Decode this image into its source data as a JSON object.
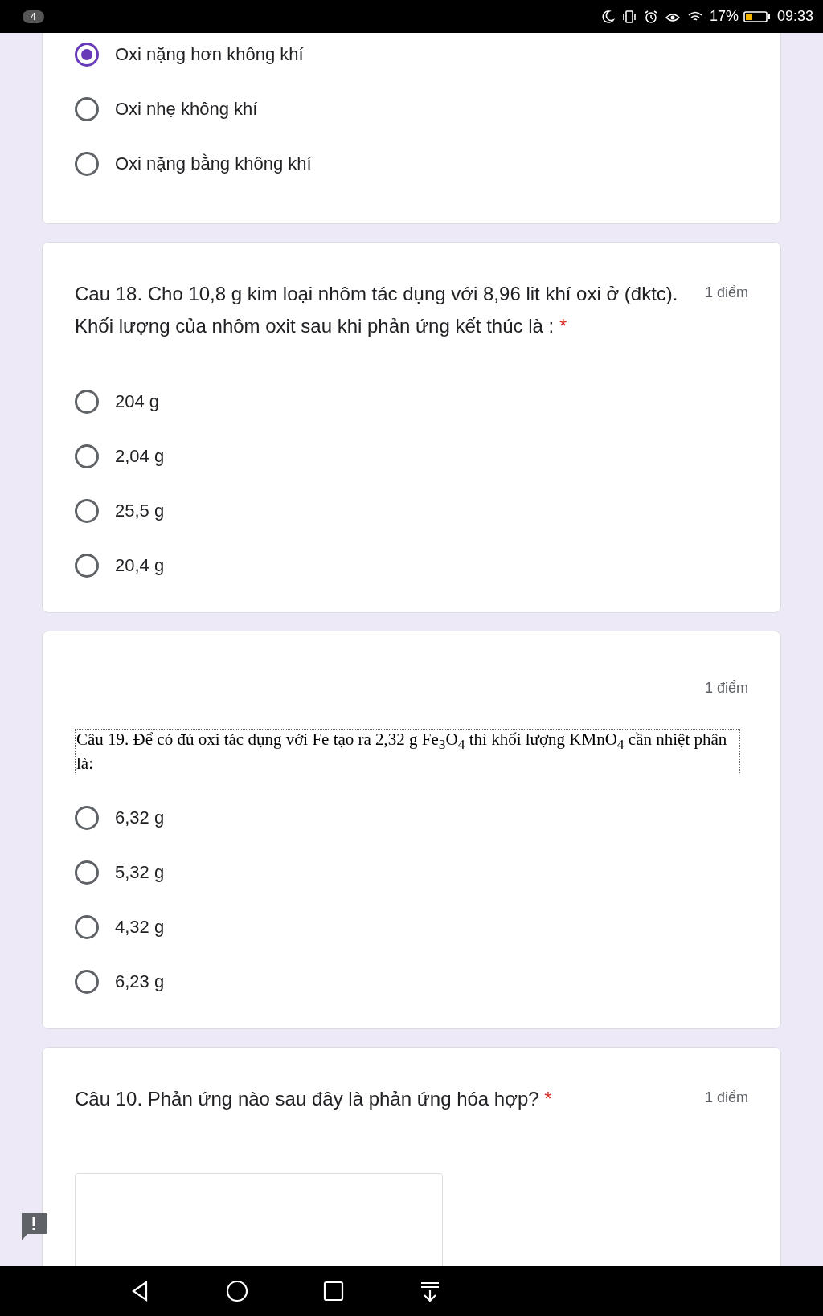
{
  "status_bar": {
    "notification_count": "4",
    "battery": "17%",
    "time": "09:33"
  },
  "questions": [
    {
      "options": [
        {
          "label": "Oxi nặng hơn không khí",
          "selected": true
        },
        {
          "label": "Oxi nhẹ không khí",
          "selected": false
        },
        {
          "label": "Oxi nặng bằng không khí",
          "selected": false
        }
      ]
    },
    {
      "title": "Cau 18. Cho 10,8 g kim loại nhôm tác dụng với 8,96 lit khí oxi ở (đktc). Khối lượng của nhôm oxit sau khi phản ứng kết thúc là :",
      "required_mark": "*",
      "points": "1 điểm",
      "options": [
        {
          "label": "204 g",
          "selected": false
        },
        {
          "label": "2,04 g",
          "selected": false
        },
        {
          "label": "25,5 g",
          "selected": false
        },
        {
          "label": "20,4 g",
          "selected": false
        }
      ]
    },
    {
      "points": "1 điểm",
      "document_text": "Câu 19. Để có đủ oxi tác dụng với Fe tạo ra 2,32 g Fe$_{3}$O$_{4}$ thì khối lượng KMnO$_{4}$ cần nhiệt phân là:",
      "options": [
        {
          "label": "6,32 g",
          "selected": false
        },
        {
          "label": "5,32 g",
          "selected": false
        },
        {
          "label": "4,32 g",
          "selected": false
        },
        {
          "label": "6,23 g",
          "selected": false
        }
      ]
    },
    {
      "title": "Câu 10. Phản ứng nào sau đây là phản ứng hóa hợp?",
      "required_mark": "*",
      "points": "1 điểm",
      "answer": {
        "kind": "text_box"
      }
    }
  ]
}
